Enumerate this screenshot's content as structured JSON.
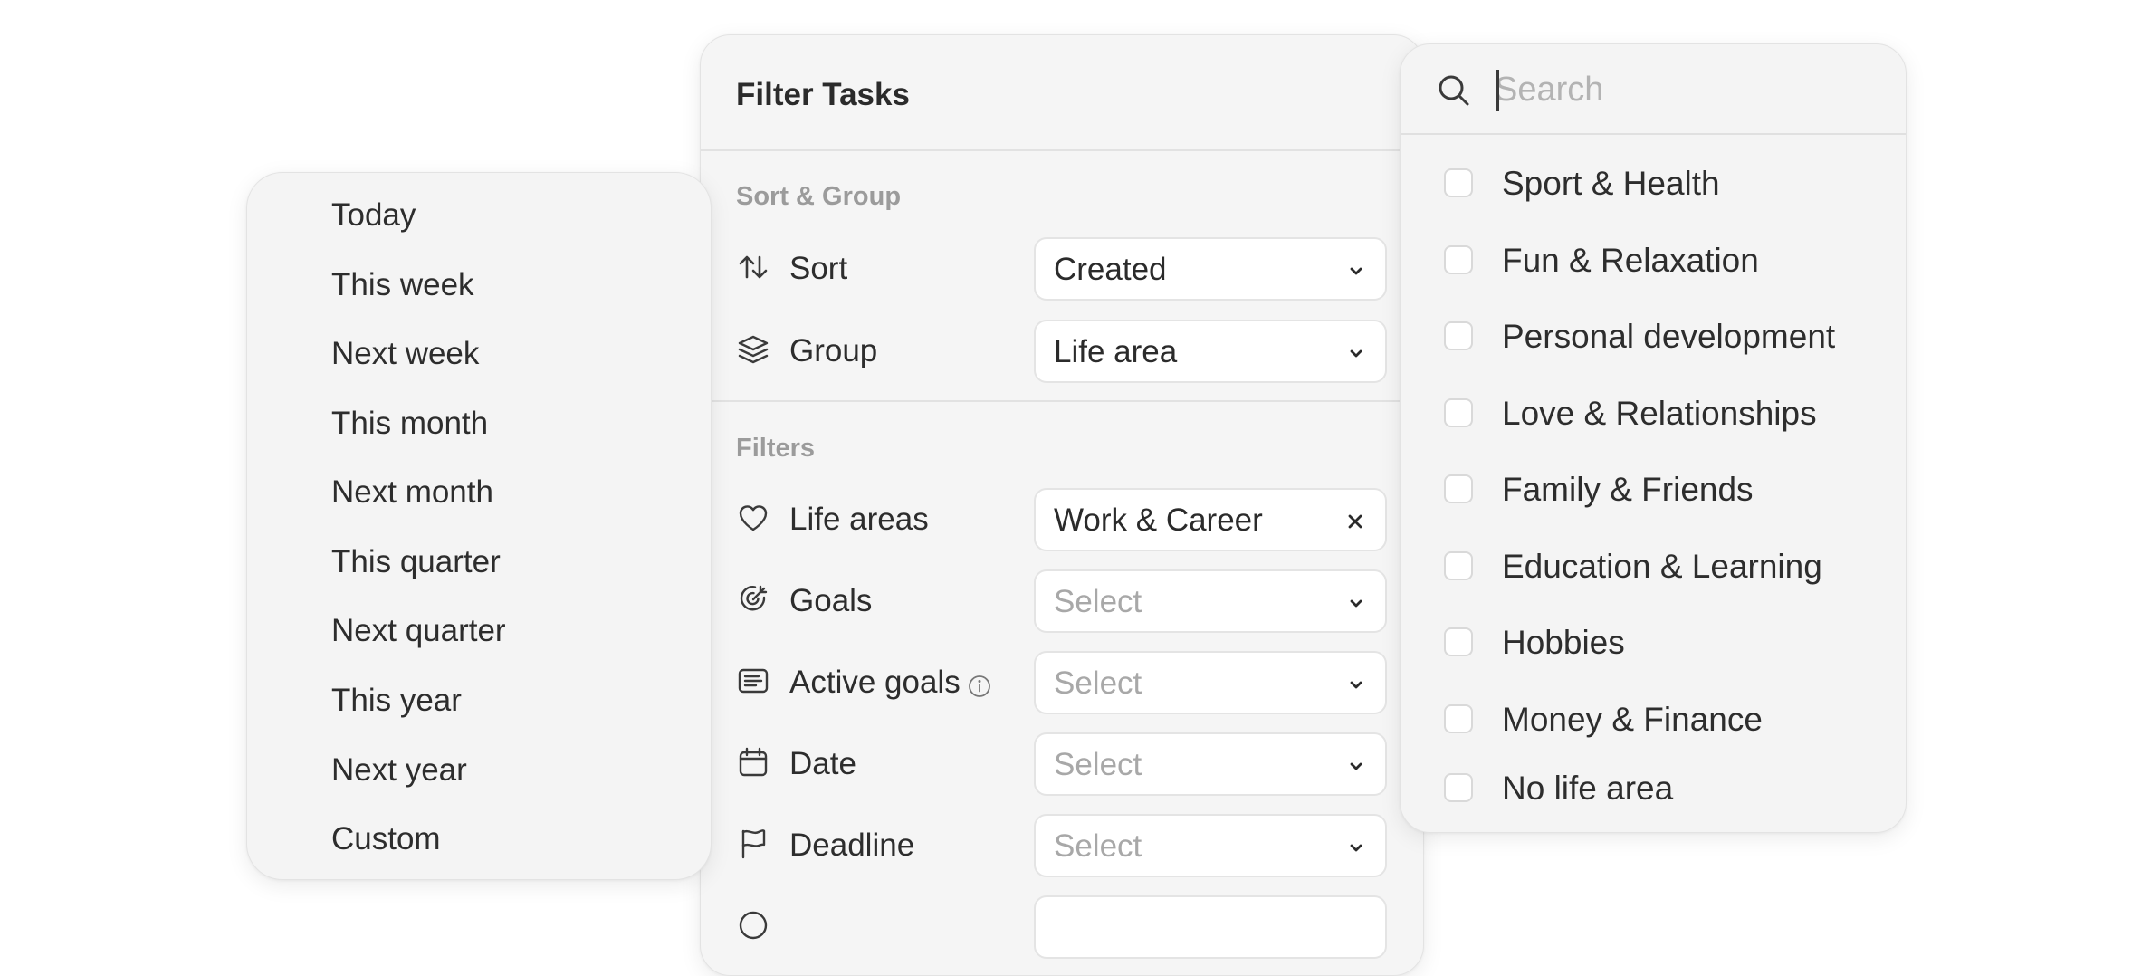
{
  "date_menu": {
    "items": [
      "Today",
      "This week",
      "Next week",
      "This month",
      "Next month",
      "This quarter",
      "Next quarter",
      "This year",
      "Next year",
      "Custom"
    ]
  },
  "filter_panel": {
    "title": "Filter Tasks",
    "sort_group_section": "Sort & Group",
    "sort_label": "Sort",
    "sort_value": "Created",
    "group_label": "Group",
    "group_value": "Life area",
    "filters_section": "Filters",
    "life_areas_label": "Life areas",
    "life_areas_value": "Work & Career",
    "goals_label": "Goals",
    "goals_value": "Select",
    "active_goals_label": "Active goals",
    "active_goals_value": "Select",
    "date_label": "Date",
    "date_value": "Select",
    "deadline_label": "Deadline",
    "deadline_value": "Select"
  },
  "lifearea_dropdown": {
    "search_placeholder": "Search",
    "options": [
      "Sport & Health",
      "Fun & Relaxation",
      "Personal development",
      "Love & Relationships",
      "Family & Friends",
      "Education & Learning",
      "Hobbies",
      "Money & Finance",
      "No life area"
    ]
  },
  "colors": {
    "panel_bg": "#f4f4f4",
    "text": "#2b2b2b",
    "muted": "#9b9b9b",
    "placeholder": "#a8a8a8"
  }
}
